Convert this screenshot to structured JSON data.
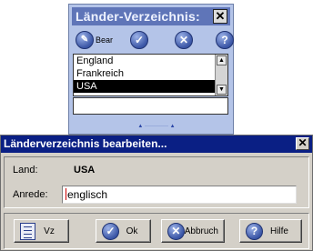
{
  "back_window": {
    "title": "Länder-Verzeichnis:",
    "close_glyph": "✕",
    "toolbar": {
      "edit_label": "Bear",
      "ok_glyph": "✓",
      "cancel_glyph": "✕",
      "help_glyph": "?"
    },
    "list": {
      "items": [
        "England",
        "Frankreich",
        "USA"
      ],
      "selected_index": 2
    },
    "splitter_glyph": "▲ ············· ▲"
  },
  "dialog": {
    "title": "Länderverzeichnis bearbeiten...",
    "close_glyph": "✕",
    "land_label": "Land:",
    "land_value": "USA",
    "anrede_label": "Anrede:",
    "anrede_value": "englisch",
    "buttons": {
      "vz": "Vz",
      "ok": "Ok",
      "ok_glyph": "✓",
      "abbruch": "Abbruch",
      "abbruch_glyph": "✕",
      "hilfe": "Hilfe",
      "hilfe_glyph": "?"
    }
  },
  "colors": {
    "back_title_bg": "#5f75b8",
    "back_window_bg": "#b4c4e8",
    "dialog_title_bg": "#0a1f84",
    "dialog_bg": "#d4d0c8",
    "icon_blue": "#3b56a6"
  }
}
